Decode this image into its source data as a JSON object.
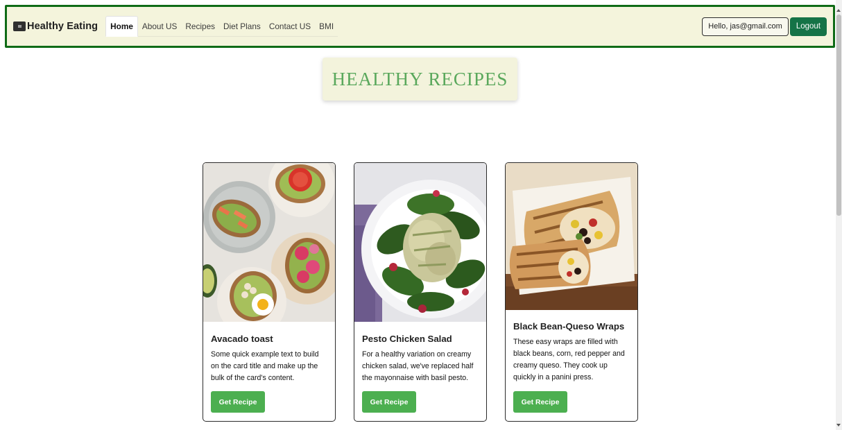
{
  "navbar": {
    "brand": "Healthy Eating",
    "links": [
      "Home",
      "About US",
      "Recipes",
      "Diet Plans",
      "Contact US",
      "BMI"
    ],
    "active_link": "Home",
    "user_greeting": "Hello, jas@gmail.com",
    "logout_label": "Logout"
  },
  "page": {
    "title": "HEALTHY RECIPES"
  },
  "cards": [
    {
      "title": "Avacado toast",
      "text": "Some quick example text to build on the card title and make up the bulk of the card's content.",
      "button": "Get Recipe",
      "image": "avocado-toast-photo"
    },
    {
      "title": "Pesto Chicken Salad",
      "text": "For a healthy variation on creamy chicken salad, we've replaced half the mayonnaise with basil pesto.",
      "button": "Get Recipe",
      "image": "pesto-chicken-salad-photo"
    },
    {
      "title": "Black Bean-Queso Wraps",
      "text": "These easy wraps are filled with black beans, corn, red pepper and creamy queso. They cook up quickly in a panini press.",
      "button": "Get Recipe",
      "image": "bean-queso-wraps-photo"
    }
  ],
  "colors": {
    "navbar_bg": "#f4f4dc",
    "navbar_border": "#0f6b16",
    "logout_bg": "#157347",
    "title_color": "#5aa85c",
    "button_bg": "#4caf50"
  }
}
